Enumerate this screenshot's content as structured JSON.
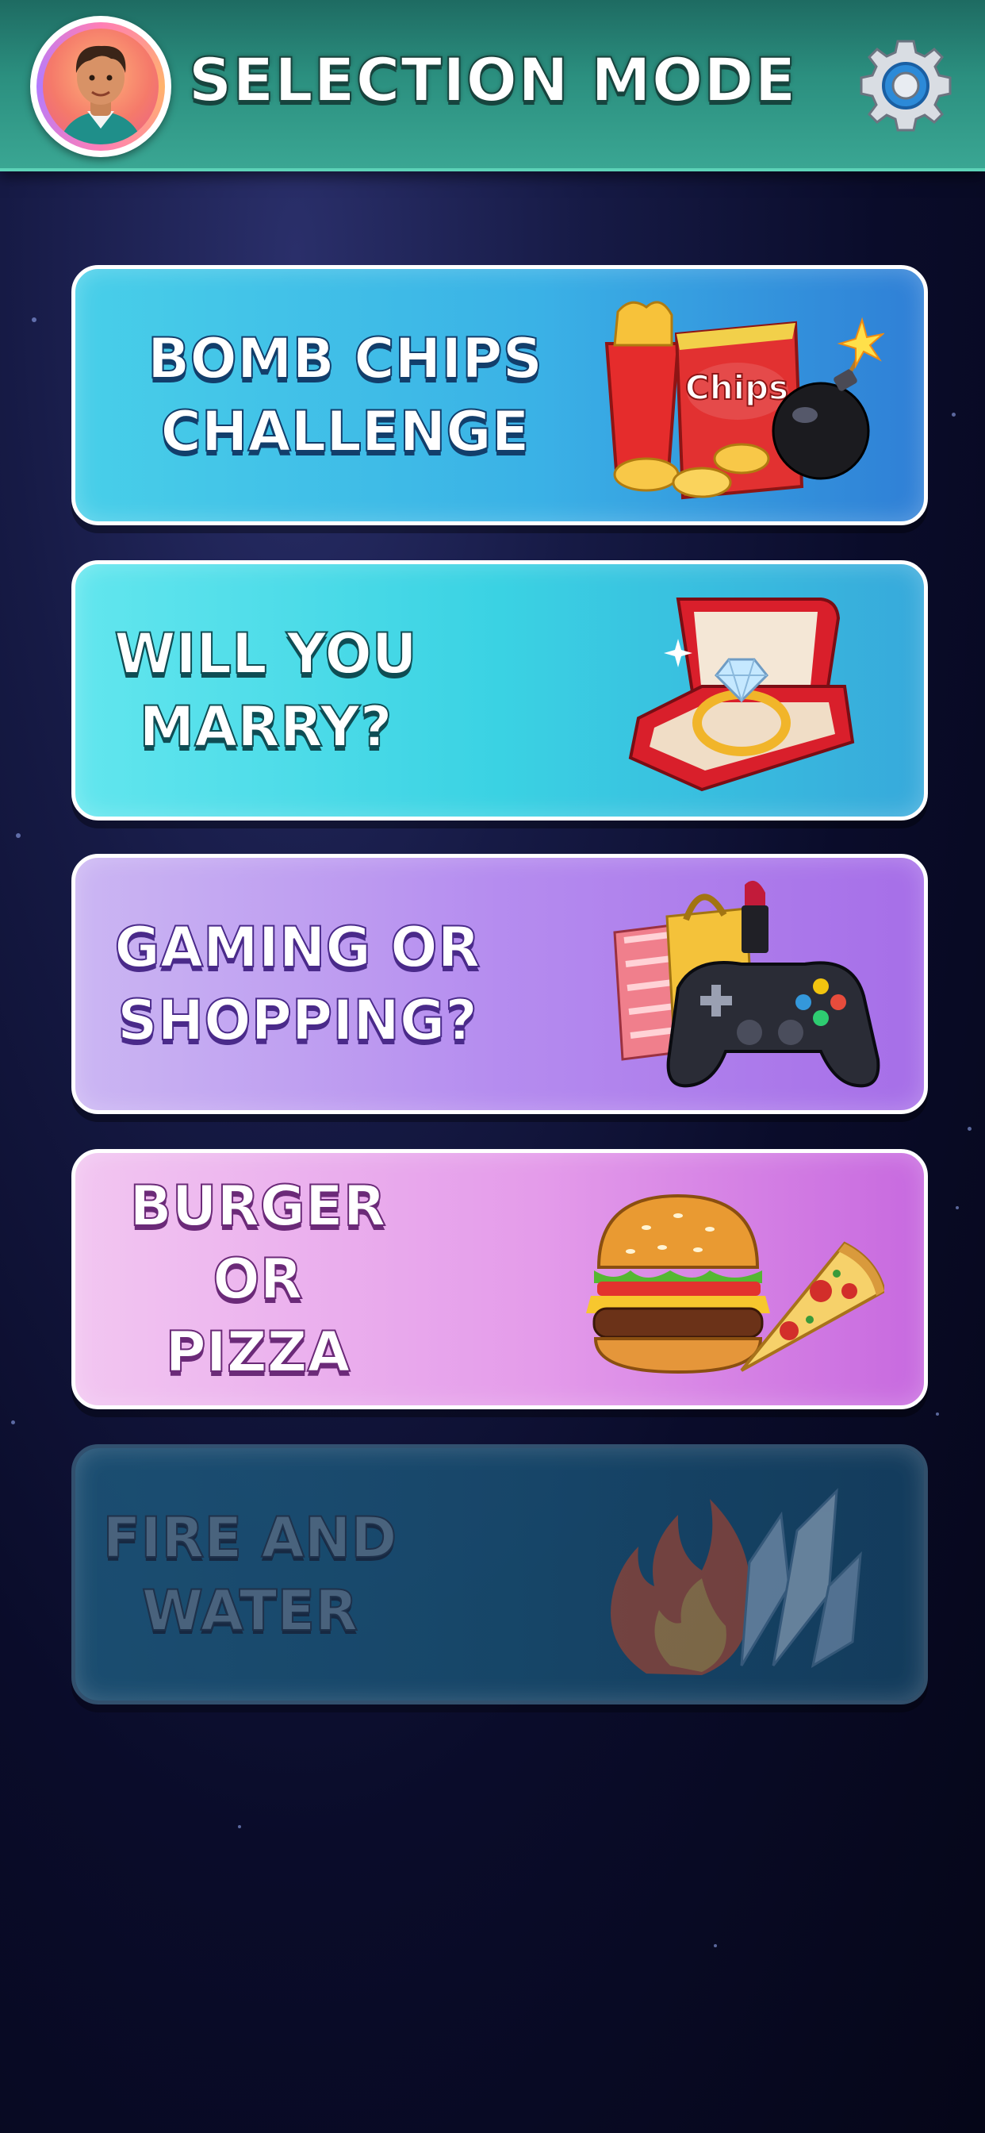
{
  "header": {
    "title": "SELECTION MODE"
  },
  "modes": [
    {
      "label": "BOMB CHIPS\nCHALLENGE",
      "art_text": "Chips",
      "locked": false
    },
    {
      "label": "WILL YOU\nMARRY?",
      "locked": false
    },
    {
      "label": "GAMING OR\nSHOPPING?",
      "locked": false
    },
    {
      "label": "BURGER\nOR PIZZA",
      "locked": false
    },
    {
      "label": "FIRE AND\nWATER",
      "locked": true
    }
  ],
  "colors": {
    "header": "#2b8f7f",
    "background": "#0a0c2a",
    "card1": "#3ab1e6",
    "card2": "#3ad2e3",
    "card3": "#b58cef",
    "card4": "#e49bea",
    "card5": "#1a5578"
  }
}
